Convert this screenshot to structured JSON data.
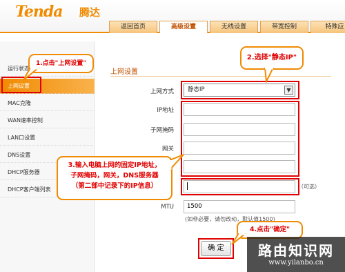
{
  "brand": {
    "logo": "Tenda",
    "logo_cn": "腾达"
  },
  "tabs": [
    {
      "label": "返回首页"
    },
    {
      "label": "高级设置"
    },
    {
      "label": "无线设置"
    },
    {
      "label": "带宽控制"
    },
    {
      "label": "特殊应"
    }
  ],
  "sidebar": {
    "items": [
      {
        "label": "运行状态"
      },
      {
        "label": "上网设置"
      },
      {
        "label": "MAC克隆"
      },
      {
        "label": "WAN速率控制"
      },
      {
        "label": "LAN口设置"
      },
      {
        "label": "DNS设置"
      },
      {
        "label": "DHCP服务器"
      },
      {
        "label": "DHCP客户端列表"
      }
    ]
  },
  "form": {
    "section_title": "上网设置",
    "mode_label": "上网方式",
    "mode_value": "静态IP",
    "ip_label": "IP地址",
    "ip_value": "",
    "mask_label": "子网掩码",
    "mask_value": "",
    "gateway_label": "网关",
    "gateway_value": "",
    "dns_value": "",
    "dns_optional": "（可选）",
    "mtu_label": "MTU",
    "mtu_value": "1500",
    "mtu_note": "(如非必要，请勿改动，默认值1500)",
    "confirm": "确 定"
  },
  "callouts": {
    "step1": "1.点击\"上网设置\"",
    "step2": "2.选择\"静态IP\"",
    "step3_line1": "3.输入电脑上网的固定IP地址，",
    "step3_line2": "子网掩码，网关，DNS服务器",
    "step3_line3": "（第二部中记录下的IP信息）",
    "step4": "4.点击\"确定\""
  },
  "watermark": {
    "title": "路由知识网",
    "url": "www.yilanbo.cn"
  },
  "colors": {
    "accent": "#f08a00",
    "highlight": "#e00000"
  }
}
